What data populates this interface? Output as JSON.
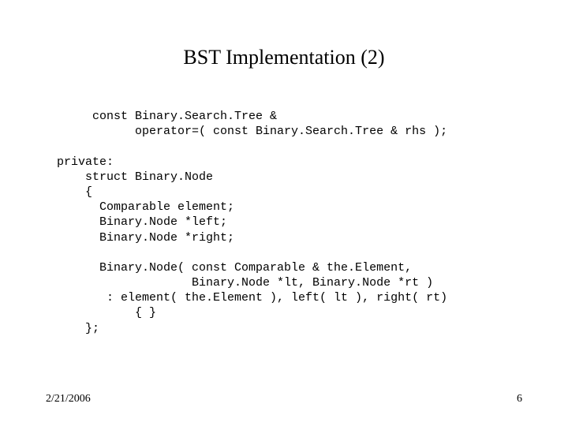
{
  "title": "BST Implementation (2)",
  "code": "     const Binary.Search.Tree &\n           operator=( const Binary.Search.Tree & rhs );\n\nprivate:\n    struct Binary.Node\n    {\n      Comparable element;\n      Binary.Node *left;\n      Binary.Node *right;\n\n      Binary.Node( const Comparable & the.Element,\n                   Binary.Node *lt, Binary.Node *rt )\n       : element( the.Element ), left( lt ), right( rt)\n           { }\n    };",
  "footer": {
    "date": "2/21/2006",
    "page": "6"
  }
}
